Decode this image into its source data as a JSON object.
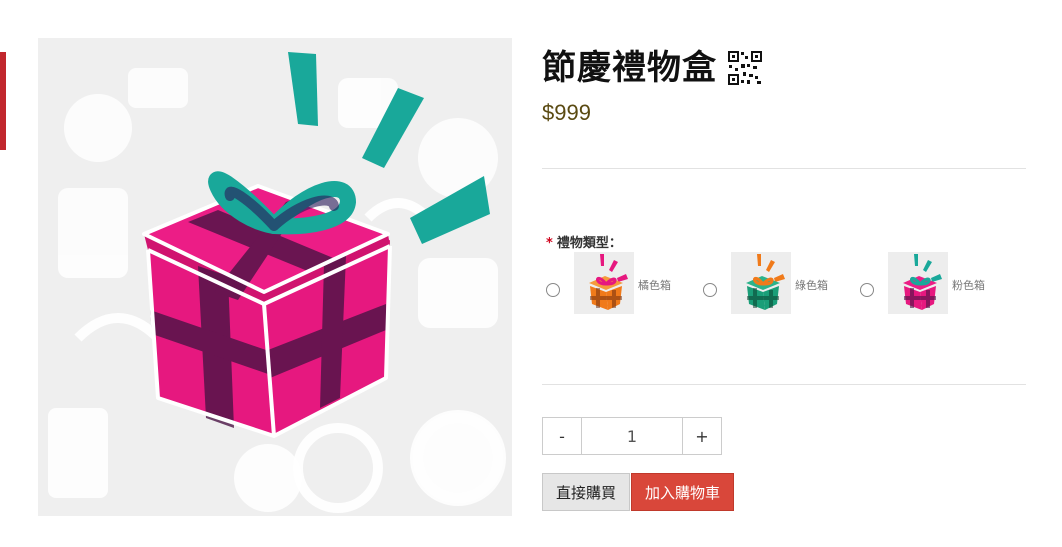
{
  "product": {
    "title": "節慶禮物盒",
    "price": "$999"
  },
  "options": {
    "label": "禮物類型：",
    "required_mark": "*",
    "items": [
      {
        "name": "橘色箱",
        "color": "#f07a1a",
        "selected": false
      },
      {
        "name": "綠色箱",
        "color": "#1a9e78",
        "selected": false
      },
      {
        "name": "粉色箱",
        "color": "#e6187f",
        "selected": false
      }
    ]
  },
  "quantity": {
    "minus_label": "-",
    "value": "1",
    "plus_label": "+"
  },
  "actions": {
    "buy_now_label": "直接購買",
    "add_to_cart_label": "加入購物車"
  },
  "colors": {
    "accent_red": "#d9473a",
    "box_pink": "#e6187f",
    "ribbon_teal": "#19a89a",
    "price_text": "#5a4a12"
  }
}
